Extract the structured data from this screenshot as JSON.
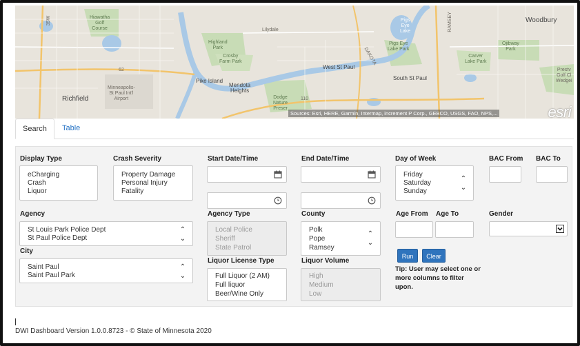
{
  "map": {
    "labels": {
      "hiawatha": "Hiawatha\nGolf\nCourse",
      "highland": "Highland\nPark",
      "crosby": "Crosby\nFarm Park",
      "lilydale": "Lilydale",
      "pigs_eye_lake": "Pigs\nEye\nLake",
      "pigs_eye_park": "Pigs Eye\nLake Park",
      "ramsey": "RAMSEY",
      "dakota": "DAKOTA",
      "woodbury": "Woodbury",
      "ojibway": "Ojibway\nPark",
      "carver": "Carver\nLake Park",
      "west_st_paul": "West St Paul",
      "south_st_paul": "South St Paul",
      "pike_island": "Pike Island",
      "mendota": "Mendota\nHeights",
      "richfield": "Richfield",
      "msp_airport": "Minneapolis-\nSt Paul Int'l\nAirport",
      "dodge": "Dodge\nNature\nPreser",
      "prestwick": "Prestv\nGolf Cl\nWedgei",
      "hwy35w": "35W",
      "hwy62": "62",
      "hwy110": "110"
    },
    "attribution": "Sources: Esri, HERE, Garmin, Intermap, increment P Corp., GEBCO, USGS, FAO, NPS,...",
    "logo": "esri"
  },
  "tabs": [
    {
      "label": "Search",
      "active": true
    },
    {
      "label": "Table",
      "active": false
    }
  ],
  "form": {
    "display_type": {
      "label": "Display Type",
      "options": [
        "eCharging",
        "Crash",
        "Liquor"
      ]
    },
    "crash_severity": {
      "label": "Crash Severity",
      "options": [
        "Property Damage",
        "Personal Injury",
        "Fatality"
      ]
    },
    "start_datetime": {
      "label": "Start Date/Time",
      "date_value": "",
      "time_value": ""
    },
    "end_datetime": {
      "label": "End Date/Time",
      "date_value": "",
      "time_value": ""
    },
    "day_of_week": {
      "label": "Day of Week",
      "options": [
        "Friday",
        "Saturday",
        "Sunday"
      ]
    },
    "bac_from": {
      "label": "BAC From",
      "value": ""
    },
    "bac_to": {
      "label": "BAC To",
      "value": ""
    },
    "agency": {
      "label": "Agency",
      "options": [
        "St Louis Park Police Dept",
        "St Paul Police Dept"
      ]
    },
    "agency_type": {
      "label": "Agency Type",
      "options": [
        "Local Police",
        "Sheriff",
        "State Patrol"
      ]
    },
    "county": {
      "label": "County",
      "options": [
        "Polk",
        "Pope",
        "Ramsey"
      ]
    },
    "age_from": {
      "label": "Age From",
      "value": ""
    },
    "age_to": {
      "label": "Age To",
      "value": ""
    },
    "gender": {
      "label": "Gender",
      "value": ""
    },
    "city": {
      "label": "City",
      "options": [
        "Saint Paul",
        "Saint Paul Park"
      ]
    },
    "liquor_license_type": {
      "label": "Liquor License Type",
      "options": [
        "Full Liquor (2 AM)",
        "Full liquor",
        "Beer/Wine Only"
      ]
    },
    "liquor_volume": {
      "label": "Liquor Volume",
      "options": [
        "High",
        "Medium",
        "Low"
      ]
    },
    "run_label": "Run",
    "clear_label": "Clear",
    "tip": "Tip: User may select one or more columns to filter upon."
  },
  "footer": "DWI Dashboard Version 1.0.0.8723 - © State of Minnesota 2020",
  "colors": {
    "accent": "#2f74bd",
    "panel_bg": "#f3f3f3",
    "disabled_bg": "#ececec",
    "tab_link": "#2a76c6"
  }
}
